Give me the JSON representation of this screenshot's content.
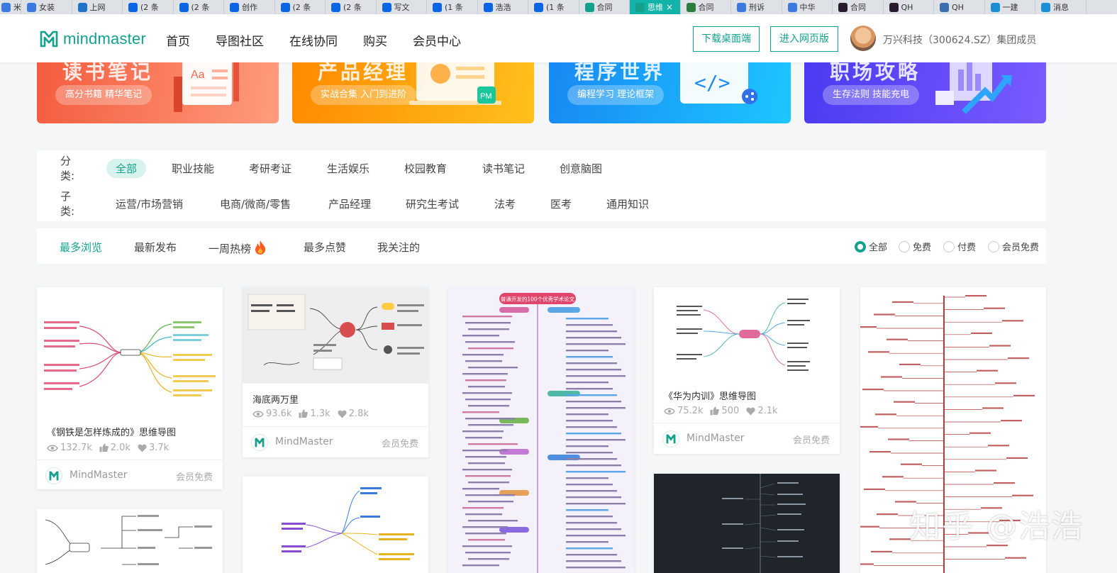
{
  "browser": {
    "tabs": [
      {
        "label": "米",
        "icon": "paw-icon",
        "color": "#3b7be0"
      },
      {
        "label": "女装",
        "icon": "paw-icon",
        "color": "#3b7be0"
      },
      {
        "label": "上网",
        "icon": "ie-icon",
        "color": "#1f73c8"
      },
      {
        "label": "(2 条",
        "icon": "zhihu-icon",
        "color": "#0a66e4"
      },
      {
        "label": "(2 条",
        "icon": "zhihu-icon",
        "color": "#0a66e4"
      },
      {
        "label": "创作",
        "icon": "zhihu-icon",
        "color": "#0a66e4"
      },
      {
        "label": "(2 条",
        "icon": "zhihu-icon",
        "color": "#0a66e4"
      },
      {
        "label": "(2 条",
        "icon": "zhihu-icon",
        "color": "#0a66e4"
      },
      {
        "label": "写文",
        "icon": "zhihu-icon",
        "color": "#0a66e4"
      },
      {
        "label": "(1 条",
        "icon": "zhihu-icon",
        "color": "#0a66e4"
      },
      {
        "label": "浩浩",
        "icon": "zhihu-icon",
        "color": "#0a66e4"
      },
      {
        "label": "(1 条",
        "icon": "zhihu-icon",
        "color": "#0a66e4"
      },
      {
        "label": "合同",
        "icon": "mindmaster-icon",
        "color": "#13a18e"
      },
      {
        "label": "思维",
        "icon": "mindmaster-icon",
        "color": "#13a18e",
        "active": true
      },
      {
        "label": "合同",
        "icon": "drive-icon",
        "color": "#2c7d3e"
      },
      {
        "label": "刑诉",
        "icon": "paw-icon",
        "color": "#3b7be0"
      },
      {
        "label": "中华",
        "icon": "paw-icon",
        "color": "#3b7be0"
      },
      {
        "label": "合同",
        "icon": "devil-icon",
        "color": "#2a1a2e"
      },
      {
        "label": "QH",
        "icon": "devil-icon",
        "color": "#2a1a2e"
      },
      {
        "label": "QH",
        "icon": "chip-icon",
        "color": "#3d6fb0"
      },
      {
        "label": "一建",
        "icon": "bili-icon",
        "color": "#1b8fd6"
      },
      {
        "label": "消息",
        "icon": "bili-icon",
        "color": "#1b8fd6"
      }
    ],
    "close_glyph": "×"
  },
  "header": {
    "logo_text": "mindmaster",
    "nav": [
      "首页",
      "导图社区",
      "在线协同",
      "购买",
      "会员中心"
    ],
    "download_button": "下载桌面端",
    "web_button": "进入网页版",
    "user": "万兴科技（300624.SZ）集团成员"
  },
  "banners": [
    {
      "title": "读书笔记",
      "pill": "高分书籍 精华笔记"
    },
    {
      "title": "产品经理",
      "pill": "实战合集 入门到进阶",
      "badge": "PM"
    },
    {
      "title": "程序世界",
      "pill": "编程学习 理论框架"
    },
    {
      "title": "职场攻略",
      "pill": "生存法则 技能充电"
    }
  ],
  "filters": {
    "category_label": "分类:",
    "categories": [
      "全部",
      "职业技能",
      "考研考证",
      "生活娱乐",
      "校园教育",
      "读书笔记",
      "创意脑图"
    ],
    "subcategory_label": "子类:",
    "subcategories": [
      "运营/市场营销",
      "电商/微商/零售",
      "产品经理",
      "研究生考试",
      "法考",
      "医考",
      "通用知识"
    ]
  },
  "sort": {
    "options": [
      "最多浏览",
      "最新发布",
      "一周热榜",
      "最多点赞",
      "我关注的"
    ],
    "price_filters": [
      "全部",
      "免费",
      "付费",
      "会员免费"
    ]
  },
  "cards": [
    {
      "title": "《钢铁是怎样炼成的》思维导图",
      "views": "132.7k",
      "likes": "2.0k",
      "favs": "3.7k",
      "author": "MindMaster",
      "tag": "会员免费"
    },
    {
      "title": "海底两万里",
      "views": "93.6k",
      "likes": "1.3k",
      "favs": "2.8k",
      "author": "MindMaster",
      "tag": "会员免费"
    },
    {
      "title": "《华为内训》思维导图",
      "views": "75.2k",
      "likes": "500",
      "favs": "2.1k",
      "author": "MindMaster",
      "tag": "会员免费"
    }
  ],
  "mindmap_title": "普通开发的100个优秀学术论文",
  "watermark": "知乎 @浩浩",
  "colors": {
    "accent": "#13a18e",
    "accent_light": "#d8f3ee"
  }
}
